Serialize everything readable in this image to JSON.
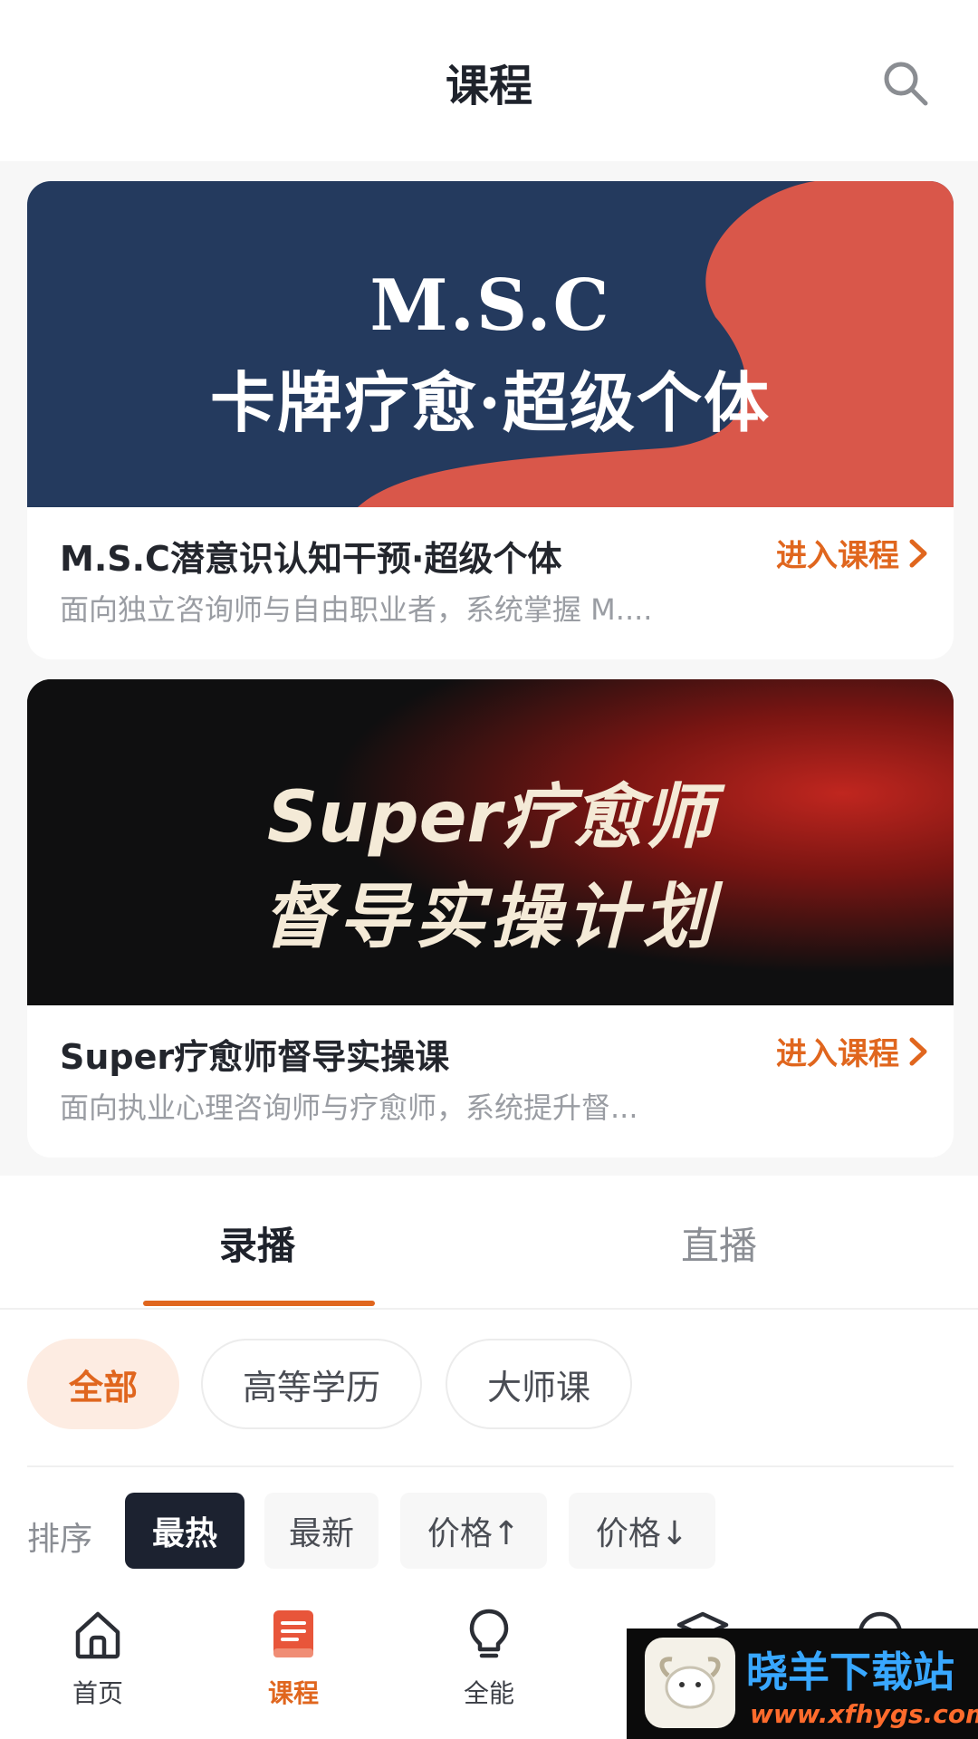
{
  "header": {
    "title": "课程",
    "search_icon": "search-icon"
  },
  "cards": [
    {
      "banner_line1": "M.S.C",
      "banner_line2": "卡牌疗愈·超级个体",
      "title": "M.S.C潜意识认知干预·超级个体",
      "description": "面向独立咨询师与自由职业者，系统掌握 M....",
      "enter_label": "进入课程",
      "colors": {
        "bg": "#243a5e",
        "accent": "#d9574a"
      }
    },
    {
      "banner_line1": "Super疗愈师",
      "banner_line2": "督导实操计划",
      "title": "Super疗愈师督导实操课",
      "description": "面向执业心理咨询师与疗愈师，系统提升督...",
      "enter_label": "进入课程",
      "colors": {
        "bg": "#0f0f10",
        "accent": "#c0261f"
      }
    }
  ],
  "tabs": [
    {
      "label": "录播",
      "active": true
    },
    {
      "label": "直播",
      "active": false
    }
  ],
  "categories": [
    {
      "label": "全部",
      "active": true
    },
    {
      "label": "高等学历",
      "active": false
    },
    {
      "label": "大师课",
      "active": false
    }
  ],
  "sort": {
    "label": "排序",
    "options": [
      {
        "label": "最热",
        "active": true
      },
      {
        "label": "最新",
        "active": false
      },
      {
        "label": "价格↑",
        "active": false
      },
      {
        "label": "价格↓",
        "active": false
      }
    ]
  },
  "bottom_nav": [
    {
      "label": "首页",
      "icon": "home-icon"
    },
    {
      "label": "课程",
      "icon": "book-icon",
      "active": true
    },
    {
      "label": "全能",
      "icon": "lightbulb-icon"
    }
  ],
  "watermark": {
    "title": "晓羊下载站",
    "url": "www.xfhygs.com"
  },
  "theme": {
    "accent": "#e0661e",
    "dark": "#1c2230"
  }
}
